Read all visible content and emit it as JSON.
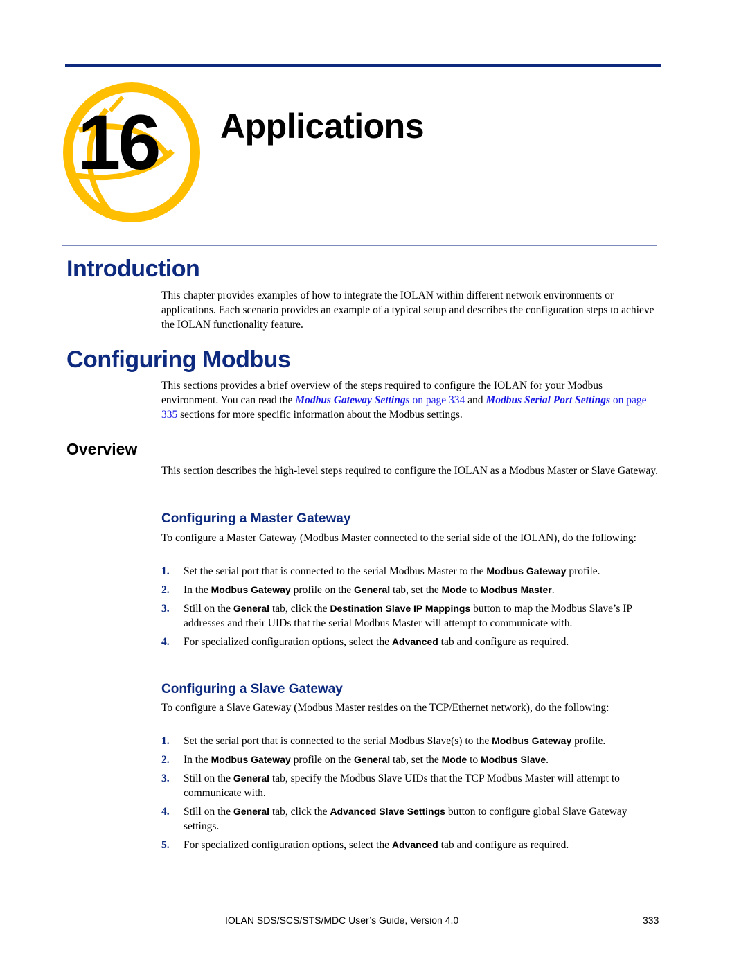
{
  "chapter": {
    "number": "16",
    "title": "Applications",
    "logo_color": "#ffbf00"
  },
  "sections": {
    "introduction": {
      "heading": "Introduction",
      "body": "This chapter provides examples of how to integrate the IOLAN within different network environments or applications. Each scenario provides an example of a typical setup and describes the configuration steps to achieve the IOLAN functionality feature."
    },
    "configuring_modbus": {
      "heading": "Configuring Modbus",
      "body_part1": "This sections provides a brief overview of the steps required to configure the IOLAN for your Modbus environment. You can read the ",
      "link1_title": "Modbus Gateway Settings",
      "link1_page": " on page 334",
      "body_part2": " and ",
      "link2_title": "Modbus Serial Port Settings",
      "link2_page": " on page 335",
      "body_part3": " sections for more specific information about the Modbus settings."
    },
    "overview": {
      "heading": "Overview",
      "body": "This section describes the high-level steps required to configure the IOLAN as a Modbus Master or Slave Gateway."
    },
    "master_gateway": {
      "heading": "Configuring a Master Gateway",
      "intro": "To configure a Master Gateway (Modbus Master connected to the serial side of the IOLAN), do the following:",
      "steps": [
        {
          "num": "1.",
          "segments": [
            {
              "t": "Set the serial port that is connected to the serial Modbus Master to the "
            },
            {
              "t": "Modbus Gateway",
              "b": true
            },
            {
              "t": " profile."
            }
          ]
        },
        {
          "num": "2.",
          "segments": [
            {
              "t": "In the "
            },
            {
              "t": "Modbus Gateway",
              "b": true
            },
            {
              "t": " profile on the "
            },
            {
              "t": "General",
              "b": true
            },
            {
              "t": " tab, set the "
            },
            {
              "t": "Mode",
              "b": true
            },
            {
              "t": " to "
            },
            {
              "t": "Modbus Master",
              "b": true
            },
            {
              "t": "."
            }
          ]
        },
        {
          "num": "3.",
          "segments": [
            {
              "t": "Still on the "
            },
            {
              "t": "General",
              "b": true
            },
            {
              "t": " tab, click the "
            },
            {
              "t": "Destination Slave IP Mappings",
              "b": true
            },
            {
              "t": " button to map the Modbus Slave’s IP addresses and their UIDs that the serial Modbus Master will attempt to communicate with."
            }
          ]
        },
        {
          "num": "4.",
          "segments": [
            {
              "t": "For specialized configuration options, select the "
            },
            {
              "t": "Advanced",
              "b": true
            },
            {
              "t": " tab and configure as required."
            }
          ]
        }
      ]
    },
    "slave_gateway": {
      "heading": "Configuring a Slave Gateway",
      "intro": "To configure a Slave Gateway (Modbus Master resides on the TCP/Ethernet network), do the following:",
      "steps": [
        {
          "num": "1.",
          "segments": [
            {
              "t": "Set the serial port that is connected to the serial Modbus Slave(s) to the "
            },
            {
              "t": "Modbus Gateway",
              "b": true
            },
            {
              "t": " profile."
            }
          ]
        },
        {
          "num": "2.",
          "segments": [
            {
              "t": "In the "
            },
            {
              "t": "Modbus Gateway",
              "b": true
            },
            {
              "t": " profile on the "
            },
            {
              "t": "General",
              "b": true
            },
            {
              "t": " tab, set the "
            },
            {
              "t": "Mode",
              "b": true
            },
            {
              "t": " to "
            },
            {
              "t": "Modbus Slave",
              "b": true
            },
            {
              "t": "."
            }
          ]
        },
        {
          "num": "3.",
          "segments": [
            {
              "t": "Still on the "
            },
            {
              "t": "General",
              "b": true
            },
            {
              "t": " tab, specify the Modbus Slave UIDs that the TCP Modbus Master will attempt to communicate with."
            }
          ]
        },
        {
          "num": "4.",
          "segments": [
            {
              "t": "Still on the "
            },
            {
              "t": "General",
              "b": true
            },
            {
              "t": " tab, click the "
            },
            {
              "t": "Advanced Slave Settings",
              "b": true
            },
            {
              "t": " button to configure global Slave Gateway settings."
            }
          ]
        },
        {
          "num": "5.",
          "segments": [
            {
              "t": "For specialized configuration options, select the "
            },
            {
              "t": "Advanced",
              "b": true
            },
            {
              "t": " tab and configure as required."
            }
          ]
        }
      ]
    }
  },
  "footer": {
    "title": "IOLAN SDS/SCS/STS/MDC User’s Guide, Version 4.0",
    "page": "333"
  }
}
